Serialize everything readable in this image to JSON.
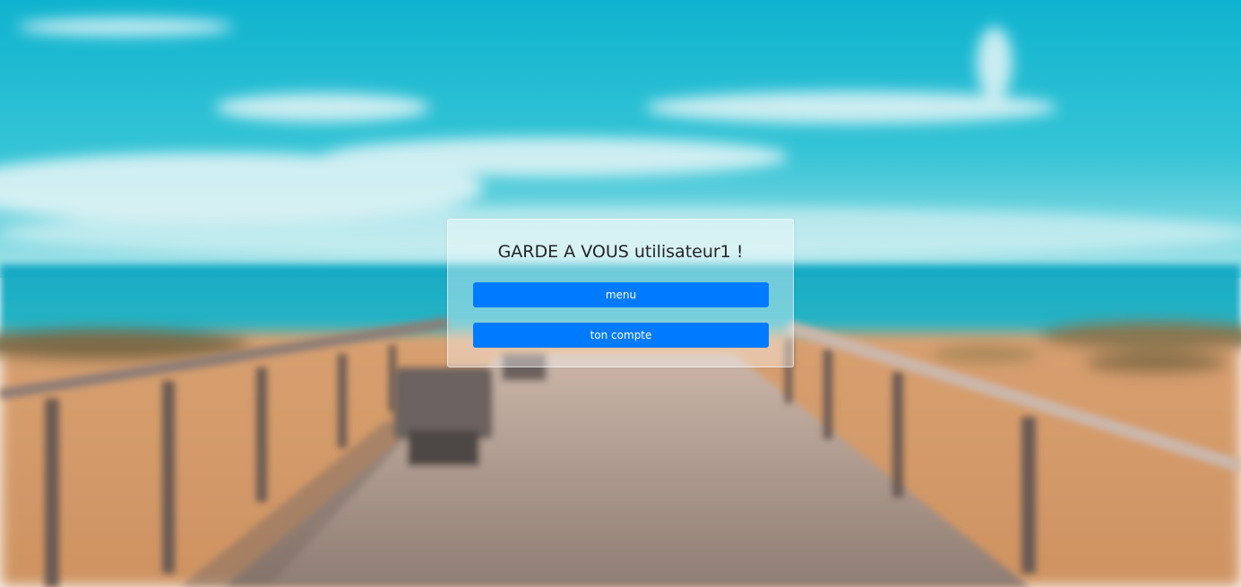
{
  "card": {
    "title": "GARDE A VOUS utilisateur1 !",
    "menu_label": "menu",
    "account_label": "ton compte"
  },
  "colors": {
    "button_primary": "#007bff",
    "button_text": "#ffffff",
    "title_text": "#212529"
  }
}
